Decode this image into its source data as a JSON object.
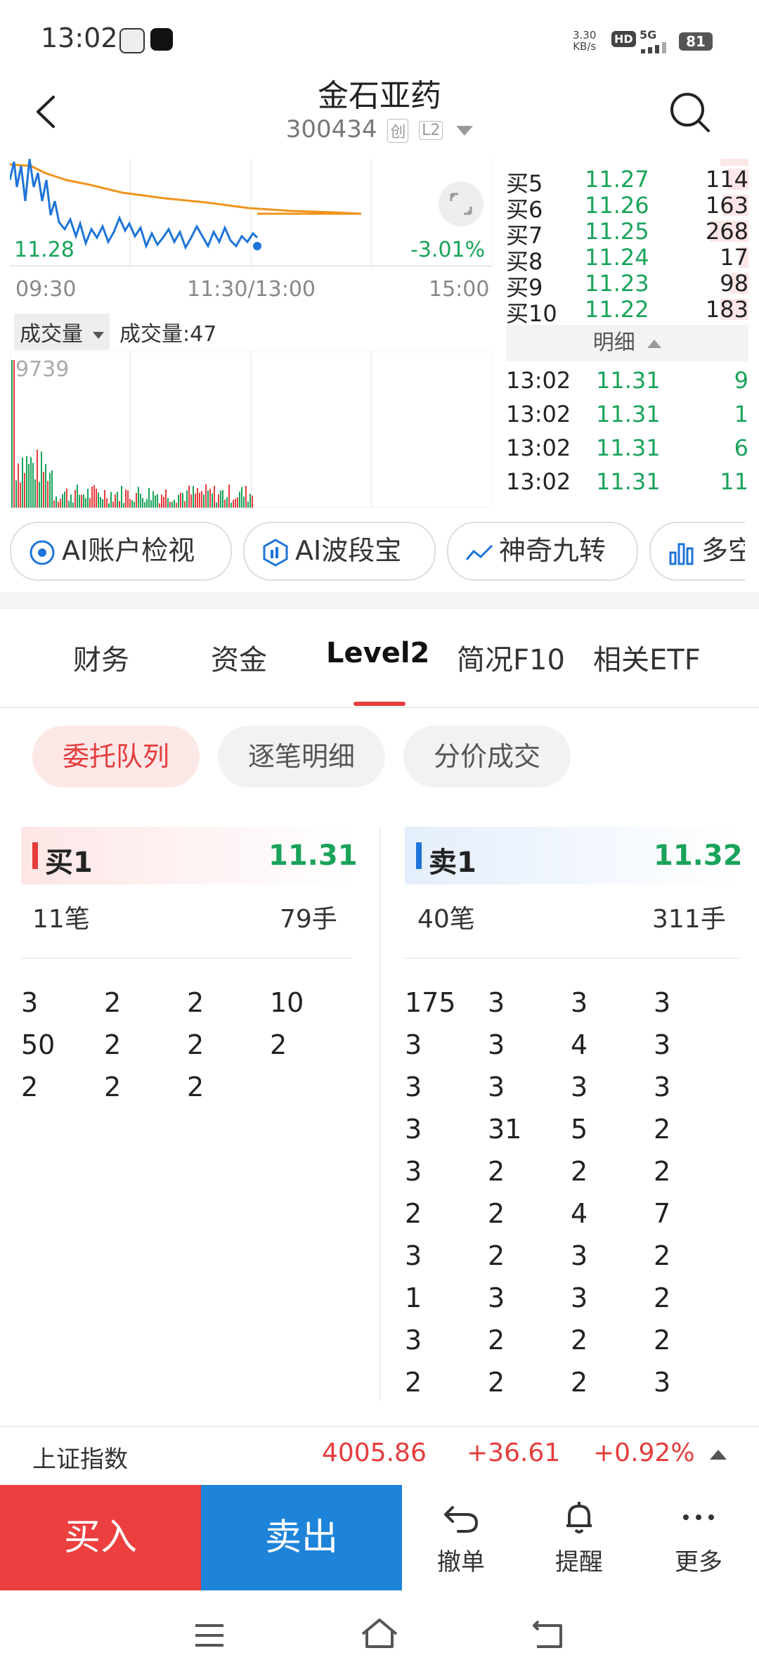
{
  "status_bar": {
    "time": "13:02",
    "net_speed_value": "3.30",
    "net_speed_unit": "KB/s",
    "hd": "HD",
    "network": "5G",
    "battery": "81"
  },
  "header": {
    "title": "金石亚药",
    "code": "300434",
    "tag1": "创",
    "tag2": "L2"
  },
  "chart": {
    "last_price": "11.28",
    "change_pct": "-3.01%",
    "time_start": "09:30",
    "time_mid": "11:30/13:00",
    "time_end": "15:00",
    "vol_select": "成交量",
    "vol_text": "成交量:47",
    "vol_max": "9739"
  },
  "order_book": [
    {
      "label": "买5",
      "price": "11.27",
      "qty": "114"
    },
    {
      "label": "买6",
      "price": "11.26",
      "qty": "163"
    },
    {
      "label": "买7",
      "price": "11.25",
      "qty": "268"
    },
    {
      "label": "买8",
      "price": "11.24",
      "qty": "17"
    },
    {
      "label": "买9",
      "price": "11.23",
      "qty": "98"
    },
    {
      "label": "买10",
      "price": "11.22",
      "qty": "183"
    }
  ],
  "detail": {
    "header": "明细",
    "ticks": [
      {
        "time": "13:02",
        "price": "11.31",
        "qty": "9"
      },
      {
        "time": "13:02",
        "price": "11.31",
        "qty": "1"
      },
      {
        "time": "13:02",
        "price": "11.31",
        "qty": "6"
      },
      {
        "time": "13:02",
        "price": "11.31",
        "qty": "11"
      }
    ]
  },
  "chips": [
    "AI账户检视",
    "AI波段宝",
    "神奇九转",
    "多空"
  ],
  "tabs": [
    "财务",
    "资金",
    "Level2",
    "简况F10",
    "相关ETF"
  ],
  "subtabs": [
    "委托队列",
    "逐笔明细",
    "分价成交"
  ],
  "buy_panel": {
    "label": "买1",
    "price": "11.31",
    "count": "11笔",
    "volume": "79手",
    "cells": [
      "3",
      "2",
      "2",
      "10",
      "50",
      "2",
      "2",
      "2",
      "2",
      "2",
      "2"
    ]
  },
  "sell_panel": {
    "label": "卖1",
    "price": "11.32",
    "count": "40笔",
    "volume": "311手",
    "cells": [
      "175",
      "3",
      "3",
      "3",
      "3",
      "3",
      "4",
      "3",
      "3",
      "3",
      "3",
      "3",
      "3",
      "31",
      "5",
      "2",
      "3",
      "2",
      "2",
      "2",
      "2",
      "2",
      "4",
      "7",
      "3",
      "2",
      "3",
      "2",
      "1",
      "3",
      "3",
      "2",
      "3",
      "2",
      "2",
      "2",
      "2",
      "2",
      "2",
      "3"
    ]
  },
  "index_bar": {
    "name": "上证指数",
    "value": "4005.86",
    "change": "+36.61",
    "pct": "+0.92%"
  },
  "actions": {
    "buy": "买入",
    "sell": "卖出",
    "cancel": "撤单",
    "alert": "提醒",
    "more": "更多"
  },
  "colors": {
    "up_red": "#e63c3c",
    "down_green": "#1aa35a",
    "sell_blue": "#1e84da"
  }
}
